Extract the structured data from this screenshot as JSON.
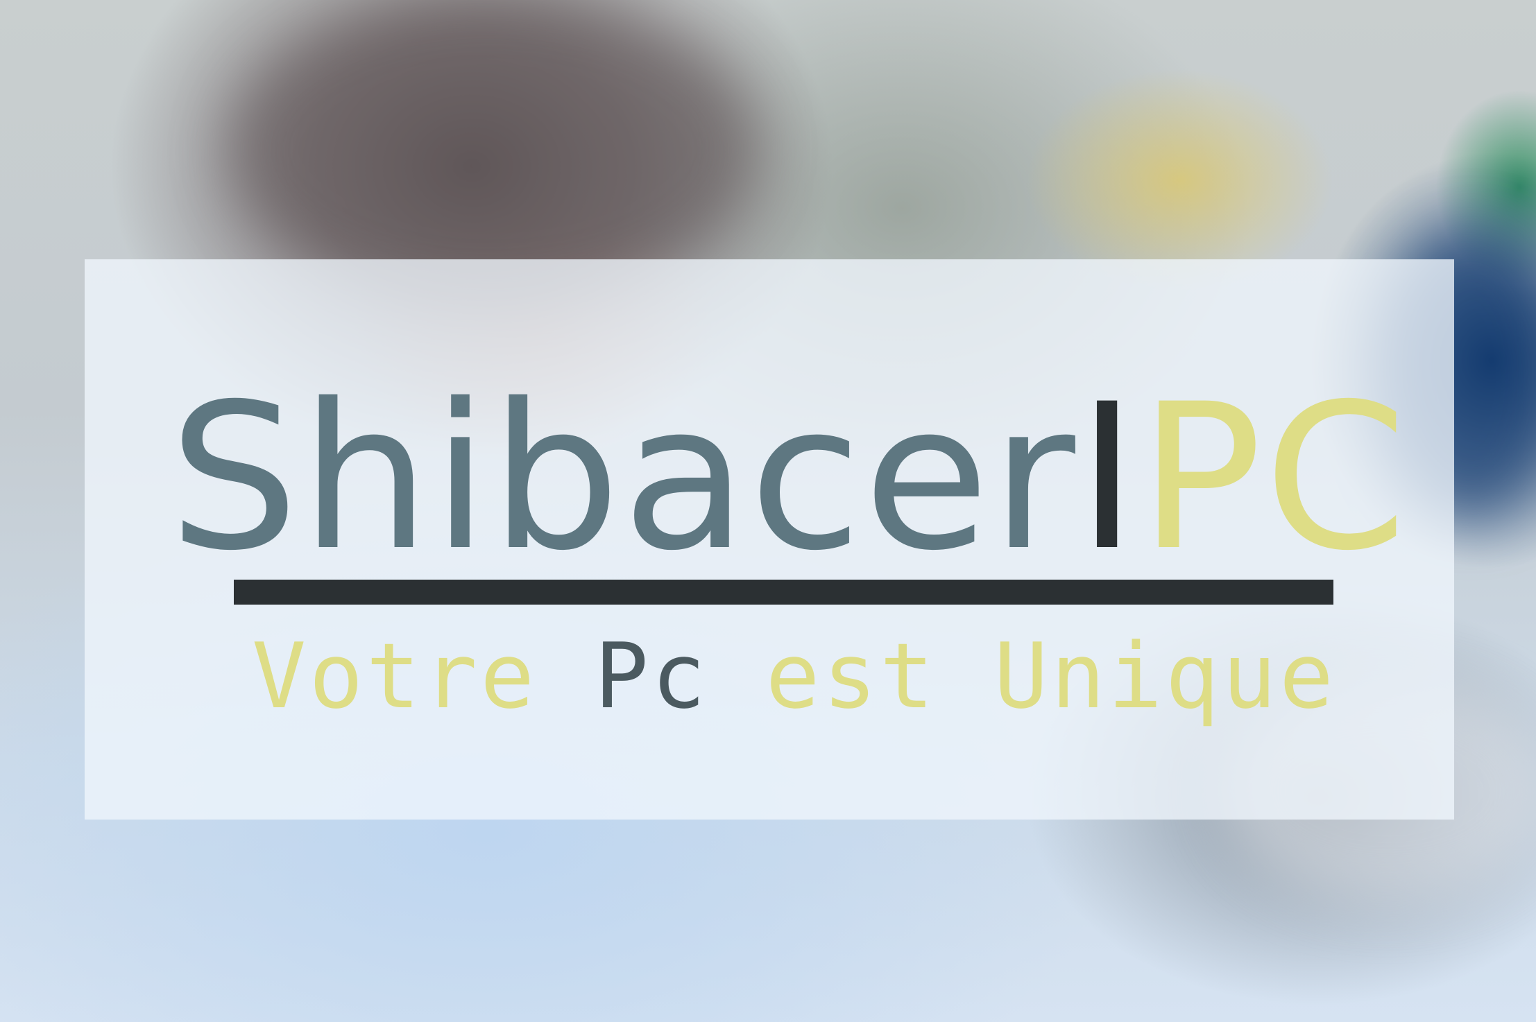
{
  "background": {
    "description_icon": "blurred-technician-photo"
  },
  "logo": {
    "part1": "Shibacer",
    "part2": "I",
    "part3": "PC",
    "colors": {
      "part1": "#5e7781",
      "part2": "#2b3033",
      "part3": "#dedd86"
    }
  },
  "tagline": {
    "word1": "Votre",
    "word2": "Pc",
    "word3": "est Unique",
    "colors": {
      "word1": "#dedd86",
      "word2": "#4b5a60",
      "word3": "#dedd86"
    }
  },
  "divider_color": "#2b3033"
}
